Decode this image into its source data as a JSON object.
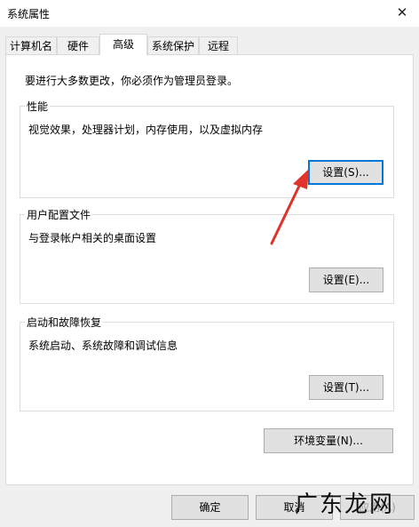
{
  "window": {
    "title": "系统属性"
  },
  "tabs": [
    {
      "label": "计算机名"
    },
    {
      "label": "硬件"
    },
    {
      "label": "高级"
    },
    {
      "label": "系统保护"
    },
    {
      "label": "远程"
    }
  ],
  "advanced": {
    "intro": "要进行大多数更改，你必须作为管理员登录。",
    "performance": {
      "title": "性能",
      "desc": "视觉效果，处理器计划，内存使用，以及虚拟内存",
      "button": "设置(S)..."
    },
    "user_profiles": {
      "title": "用户配置文件",
      "desc": "与登录帐户相关的桌面设置",
      "button": "设置(E)..."
    },
    "startup_recovery": {
      "title": "启动和故障恢复",
      "desc": "系统启动、系统故障和调试信息",
      "button": "设置(T)..."
    },
    "env_vars_button": "环境变量(N)..."
  },
  "footer": {
    "ok": "确定",
    "cancel": "取消",
    "apply": "应用(A)"
  },
  "watermark": {
    "text": "广东龙网"
  },
  "colors": {
    "focus_border": "#0078d7",
    "arrow": "#e0332b"
  }
}
